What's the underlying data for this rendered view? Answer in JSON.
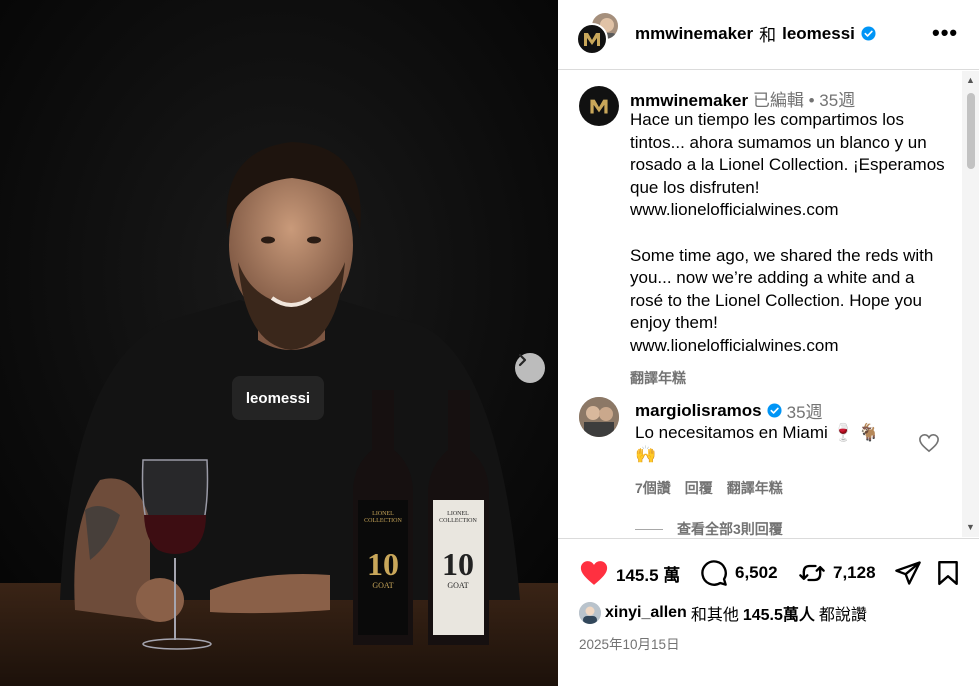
{
  "post": {
    "tag_label": "leomessi"
  },
  "header": {
    "user1": "mmwinemaker",
    "conjunction": "和",
    "user2": "leomessi",
    "more_label": "•••"
  },
  "caption": {
    "username": "mmwinemaker",
    "edited": "已編輯",
    "dot": "•",
    "time": "35週",
    "text": "Hace un tiempo les compartimos los tintos... ahora sumamos un blanco y un rosado a la Lionel Collection. ¡Esperamos que los disfruten!\nwww.lionelofficialwines.com\n\nSome time ago, we shared the reds with you... now we’re adding a white and a rosé to the Lionel Collection. Hope you enjoy them!\nwww.lionelofficialwines.com",
    "translate_label": "翻譯年糕"
  },
  "comment": {
    "username": "margiolisramos",
    "time": "35週",
    "text": "Lo necesitamos en Miami 🍷 🐐 🙌",
    "likes_label": "7個讚",
    "reply_label": "回覆",
    "translate_label": "翻譯年糕",
    "view_replies_label": "查看全部3則回覆"
  },
  "actions": {
    "like_count": "145.5 萬",
    "comment_count": "6,502",
    "repost_count": "7,128"
  },
  "likes_summary": {
    "user": "xinyi_allen",
    "and_others": "和其他",
    "count": "145.5萬人",
    "suffix": "都說讚"
  },
  "date": "2025年10月15日",
  "colors": {
    "like_red": "#ff3040",
    "verified_blue": "#0095f6",
    "muted_text": "#737373"
  }
}
